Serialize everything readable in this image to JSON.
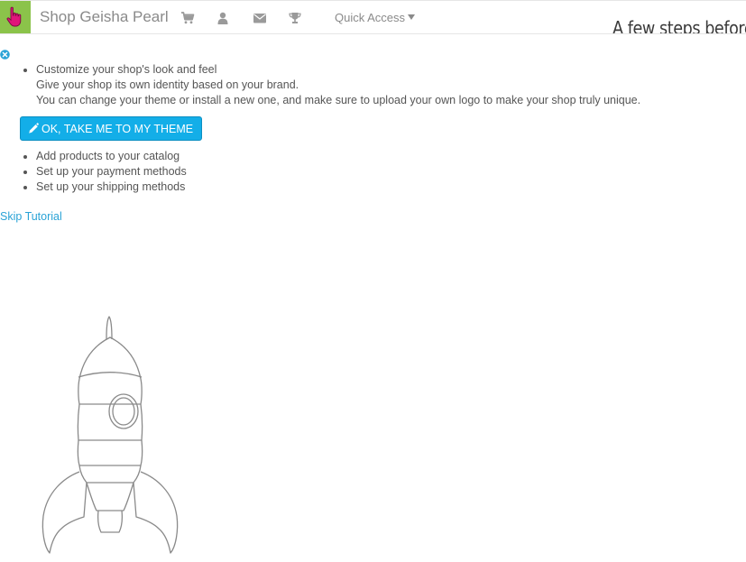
{
  "header": {
    "shop_name": "Shop Geisha Pearl",
    "quick_access_label": "Quick Access",
    "steps_heading": "A few steps before l",
    "icons": [
      "cart-icon",
      "user-icon",
      "envelope-icon",
      "trophy-icon"
    ]
  },
  "tutorial": {
    "steps": [
      {
        "title": "Customize your shop's look and feel",
        "lines": [
          "Give your shop its own identity based on your brand.",
          "You can change your theme or install a new one, and make sure to upload your own logo to make your shop truly unique."
        ]
      },
      {
        "title": "Add products to your catalog"
      },
      {
        "title": "Set up your payment methods"
      },
      {
        "title": "Set up your shipping methods"
      }
    ],
    "theme_button_label": "OK, TAKE ME TO MY THEME",
    "skip_label": "Skip Tutorial"
  },
  "colors": {
    "logo_bg": "#8bc34a",
    "primary_button": "#13aee8",
    "link": "#2aa3d6"
  }
}
